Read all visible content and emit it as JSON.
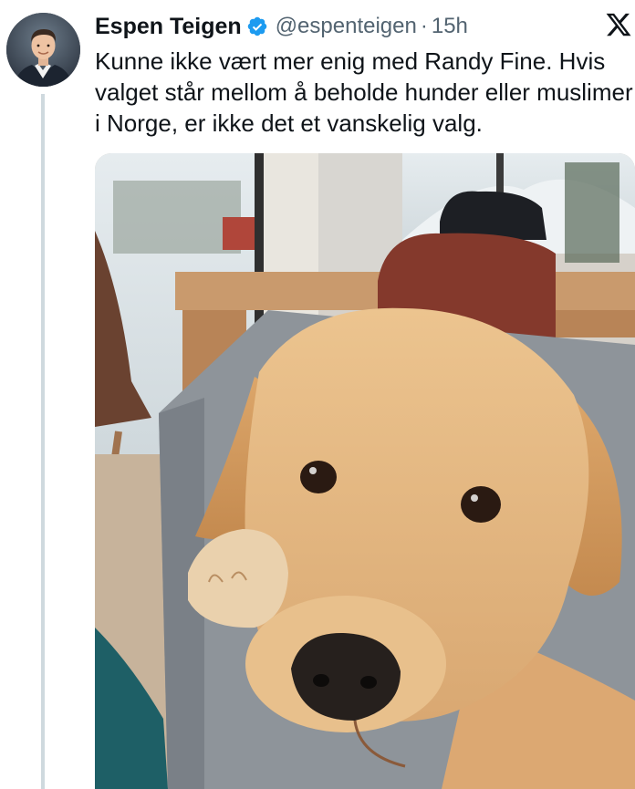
{
  "tweet": {
    "author": {
      "display_name": "Espen Teigen",
      "handle": "@espenteigen",
      "verified": true,
      "avatar_icon": "profile-photo"
    },
    "separator": "·",
    "timestamp": "15h",
    "text": "Kunne ikke vært mer enig med Randy Fine. Hvis valget står mellom å beholde hunder eller muslimer i Norge, er ikke det et vanskelig valg.",
    "media": {
      "type": "photo"
    }
  },
  "branding": {
    "logo_icon": "x-logo-icon"
  },
  "colors": {
    "text_primary": "#0f1419",
    "text_secondary": "#536471",
    "verified_badge": "#1d9bf0",
    "thread_line": "#cfd9de"
  }
}
